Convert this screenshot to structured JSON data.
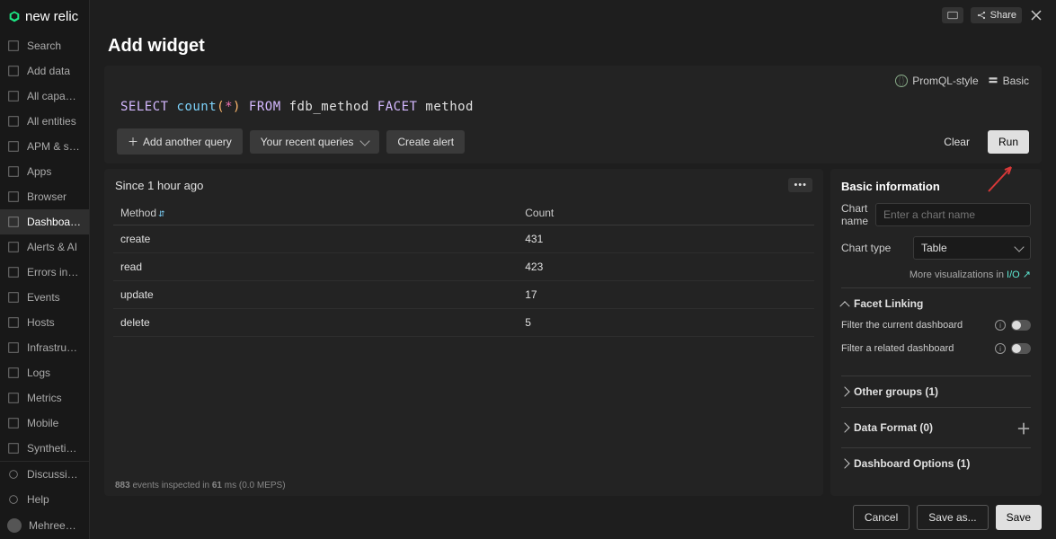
{
  "brand": "new relic",
  "topbar": {
    "share": "Share"
  },
  "page_title": "Add widget",
  "nav": {
    "items": [
      {
        "label": "Search",
        "icon": "search-icon"
      },
      {
        "label": "Add data",
        "icon": "plus-icon"
      },
      {
        "label": "All capabilities",
        "icon": "grid-icon"
      },
      {
        "label": "All entities",
        "icon": "target-icon"
      },
      {
        "label": "APM & services",
        "icon": "gauge-icon"
      },
      {
        "label": "Apps",
        "icon": "hex-icon"
      },
      {
        "label": "Browser",
        "icon": "browser-icon"
      },
      {
        "label": "Dashboards",
        "icon": "dashboard-icon",
        "active": true
      },
      {
        "label": "Alerts & AI",
        "icon": "bell-icon"
      },
      {
        "label": "Errors inbox",
        "icon": "inbox-icon"
      },
      {
        "label": "Events",
        "icon": "events-icon"
      },
      {
        "label": "Hosts",
        "icon": "server-icon"
      },
      {
        "label": "Infrastructure",
        "icon": "layers-icon"
      },
      {
        "label": "Logs",
        "icon": "logs-icon"
      },
      {
        "label": "Metrics",
        "icon": "metrics-icon"
      },
      {
        "label": "Mobile",
        "icon": "mobile-icon"
      },
      {
        "label": "Synthetic monitori",
        "icon": "synth-icon"
      }
    ],
    "footer": [
      {
        "label": "Discussions",
        "icon": "chat-icon"
      },
      {
        "label": "Help",
        "icon": "help-icon"
      },
      {
        "label": "Mehreen Tahir",
        "icon": "avatar"
      }
    ]
  },
  "query": {
    "promql": "PromQL-style",
    "basic": "Basic",
    "tokens": {
      "select": "SELECT",
      "count": "count",
      "lparen": "(",
      "star": "*",
      "rparen": ")",
      "from": "FROM",
      "table": "fdb_method",
      "facet": "FACET",
      "column": "method"
    },
    "actions": {
      "add": "Add another query",
      "recent": "Your recent queries",
      "alert": "Create alert",
      "clear": "Clear",
      "run": "Run"
    }
  },
  "result": {
    "timerange": "Since 1 hour ago",
    "columns": [
      "Method",
      "Count"
    ],
    "rows": [
      {
        "method": "create",
        "count": "431"
      },
      {
        "method": "read",
        "count": "423"
      },
      {
        "method": "update",
        "count": "17"
      },
      {
        "method": "delete",
        "count": "5"
      }
    ],
    "footer": {
      "events": "883",
      "inspected_in": " events inspected in ",
      "ms": "61",
      "ms_label": " ms ",
      "meps": "(0.0",
      "meps_label": " MEPS)"
    }
  },
  "config": {
    "basic_info": "Basic information",
    "chart_name_label": "Chart name",
    "chart_name_placeholder": "Enter a chart name",
    "chart_type_label": "Chart type",
    "chart_type_value": "Table",
    "more_viz": "More visualizations in ",
    "io": "I/O",
    "facet_linking": "Facet Linking",
    "filter_current": "Filter the current dashboard",
    "filter_related": "Filter a related dashboard",
    "other_groups": "Other groups (1)",
    "data_format": "Data Format (0)",
    "dashboard_options": "Dashboard Options (1)"
  },
  "footer": {
    "cancel": "Cancel",
    "save_as": "Save as...",
    "save": "Save"
  },
  "chart_data": {
    "type": "table",
    "title": "",
    "columns": [
      "Method",
      "Count"
    ],
    "rows": [
      [
        "create",
        431
      ],
      [
        "read",
        423
      ],
      [
        "update",
        17
      ],
      [
        "delete",
        5
      ]
    ],
    "timerange": "Since 1 hour ago"
  }
}
